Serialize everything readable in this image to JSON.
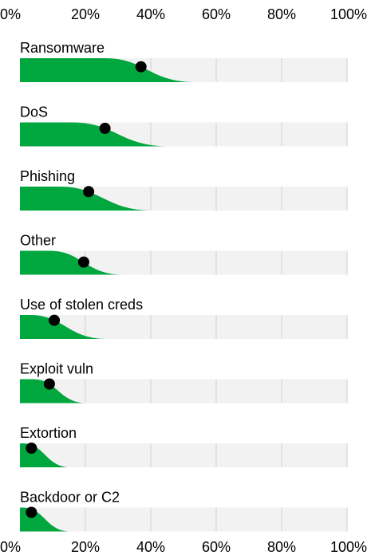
{
  "chart_data": {
    "type": "area",
    "x_ticks": [
      "0%",
      "20%",
      "40%",
      "60%",
      "80%",
      "100%"
    ],
    "xlim": [
      0,
      100
    ],
    "grid": true,
    "colors": {
      "fill": "#00a63e",
      "point": "#000000",
      "track": "#f2f2f2",
      "grid": "#d6d6d6",
      "text": "#000000"
    },
    "series": [
      {
        "name": "Ransomware",
        "median": 37,
        "extent": 53,
        "plateau": 26
      },
      {
        "name": "DoS",
        "median": 26,
        "extent": 45,
        "plateau": 16
      },
      {
        "name": "Phishing",
        "median": 21,
        "extent": 40,
        "plateau": 12
      },
      {
        "name": "Other",
        "median": 19.5,
        "extent": 31,
        "plateau": 9
      },
      {
        "name": "Use of stolen creds",
        "median": 10.5,
        "extent": 26,
        "plateau": 3
      },
      {
        "name": "Exploit vuln",
        "median": 9,
        "extent": 20,
        "plateau": 4
      },
      {
        "name": "Extortion",
        "median": 3.5,
        "extent": 15,
        "plateau": 1
      },
      {
        "name": "Backdoor or C2",
        "median": 3.5,
        "extent": 15,
        "plateau": 1
      }
    ]
  }
}
